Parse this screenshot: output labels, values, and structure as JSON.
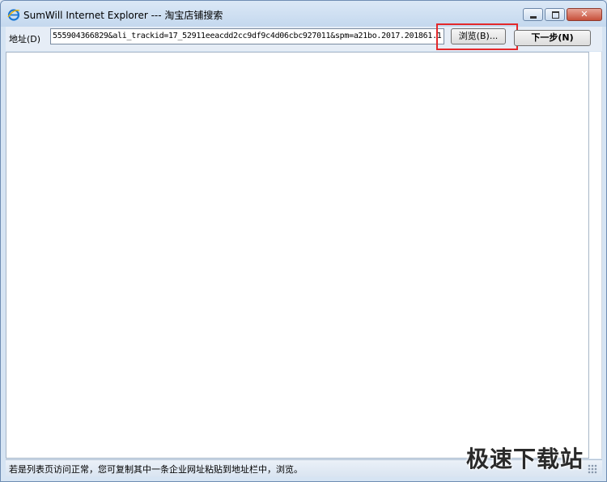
{
  "window": {
    "title": "SumWill Internet Explorer --- 淘宝店铺搜索",
    "icon": "ie-icon",
    "controls": {
      "minimize": "minimize-icon",
      "maximize": "maximize-icon",
      "close": "close-icon"
    }
  },
  "toolbar": {
    "address_label": "地址(D)",
    "address_value": "555904366829&ali_trackid=17_52911eeacdd2cc9df9c4d06cbc927011&spm=a21bo.2017.201861.1",
    "browse_label": "浏览(B)...",
    "next_label": "下一步(N)"
  },
  "status": {
    "text": "若是列表页访问正常，您可复制其中一条企业网址粘贴到地址栏中，浏览。"
  },
  "watermark": {
    "text": "极速下载站"
  },
  "colors": {
    "highlight": "#e3282b",
    "window_border": "#6f8db3"
  }
}
